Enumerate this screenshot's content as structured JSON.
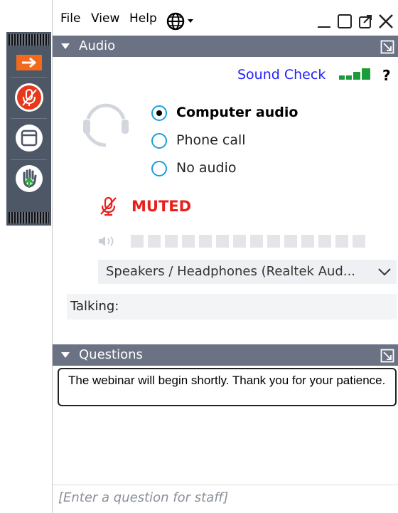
{
  "menu": {
    "file": "File",
    "view": "View",
    "help": "Help"
  },
  "sidebar": {
    "buttons": [
      {
        "name": "toggle-panel",
        "icon": "arrow-right-icon"
      },
      {
        "name": "microphone",
        "icon": "microphone-muted-icon"
      },
      {
        "name": "screen",
        "icon": "window-icon"
      },
      {
        "name": "raise-hand",
        "icon": "hand-icon"
      }
    ]
  },
  "audio": {
    "title": "Audio",
    "sound_check": "Sound Check",
    "help": "?",
    "options": [
      {
        "label": "Computer audio",
        "selected": true
      },
      {
        "label": "Phone call",
        "selected": false
      },
      {
        "label": "No audio",
        "selected": false
      }
    ],
    "status": "MUTED",
    "device": "Speakers / Headphones (Realtek Aud...",
    "talking_label": "Talking:"
  },
  "questions": {
    "title": "Questions",
    "message": "The webinar will begin shortly.  Thank you for your patience.",
    "input_placeholder": "[Enter a question for staff]"
  },
  "colors": {
    "header": "#6b7283",
    "accent": "#1a9fd8",
    "muted": "#e8201c",
    "sound_check": "#2020ff",
    "signal": "#1a9c3a",
    "sidebar": "#4d5766"
  }
}
